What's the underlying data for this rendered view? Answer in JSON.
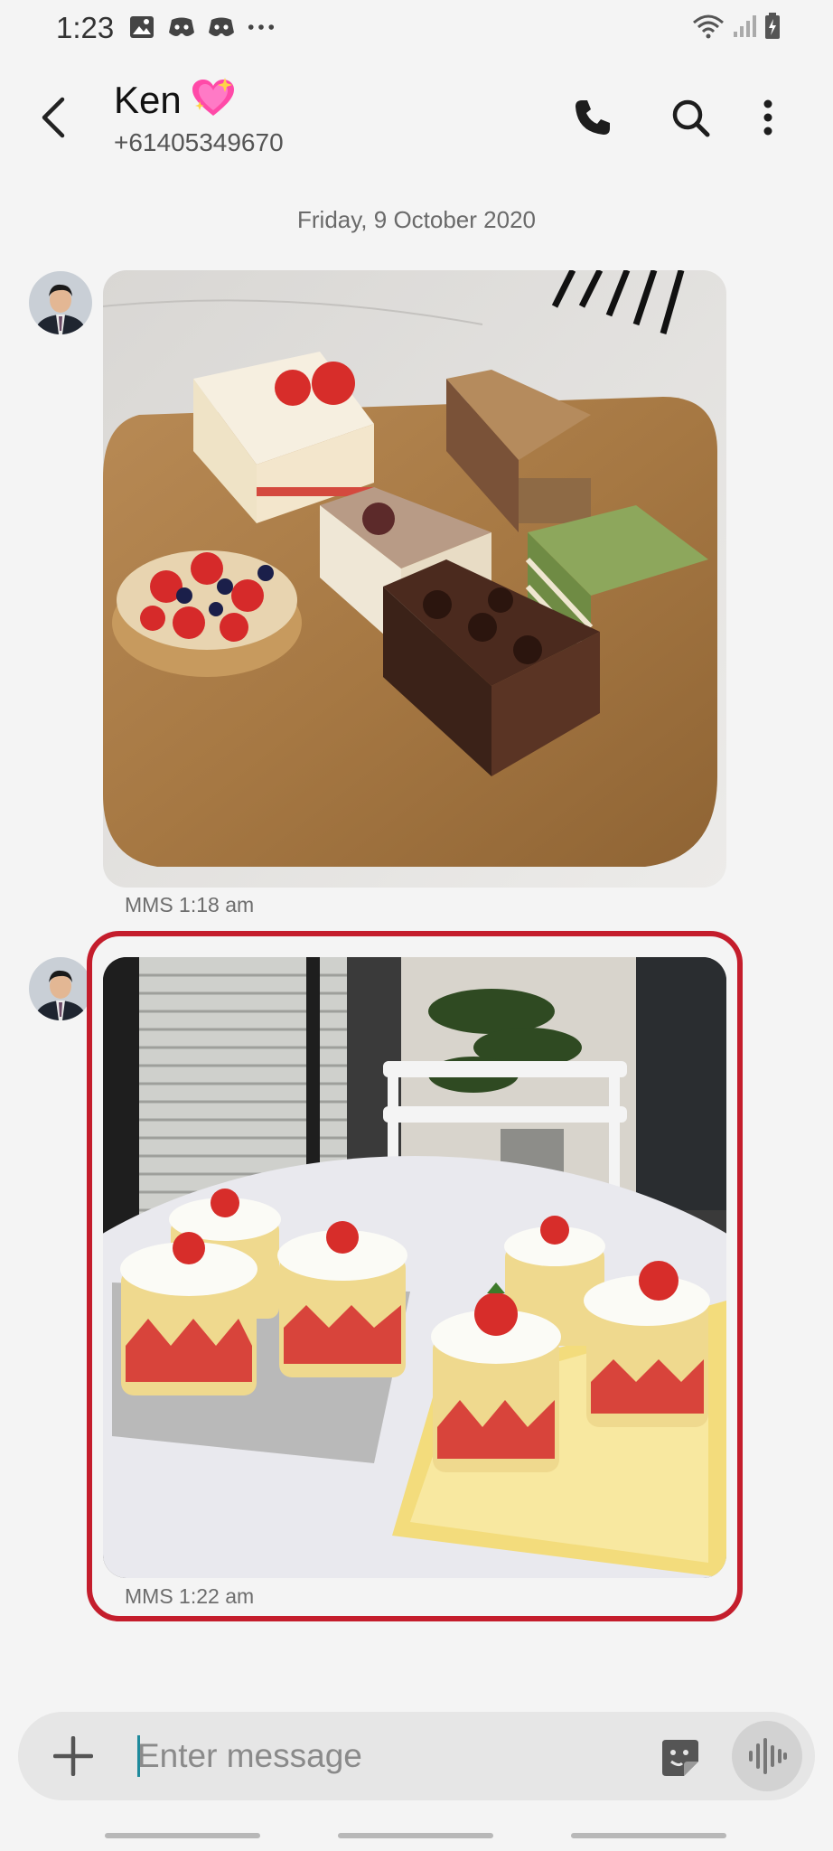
{
  "status_bar": {
    "time": "1:23",
    "left_icons": [
      "image-icon",
      "discord-icon",
      "discord-icon",
      "more-dots-icon"
    ],
    "right_icons": [
      "wifi-icon",
      "signal-icon",
      "battery-charging-icon"
    ]
  },
  "header": {
    "contact_name": "Ken",
    "contact_emoji": "💖",
    "phone_number": "+61405349670",
    "actions": [
      "phone-icon",
      "search-icon",
      "more-vertical-icon"
    ]
  },
  "conversation": {
    "date_divider": "Friday, 9 October 2020",
    "messages": [
      {
        "type": "image",
        "image_subject": "assorted-cakes-on-wooden-tray",
        "meta": "MMS 1:18 am"
      },
      {
        "type": "image",
        "image_subject": "strawberry-mini-cakes-on-trays",
        "meta": "MMS 1:22 am",
        "highlighted": true
      }
    ]
  },
  "compose": {
    "placeholder": "Enter message",
    "value": ""
  },
  "colors": {
    "background": "#f4f4f4",
    "highlight": "#c41d2c",
    "caret": "#1f8a9c",
    "compose_bg": "#e6e6e6"
  }
}
